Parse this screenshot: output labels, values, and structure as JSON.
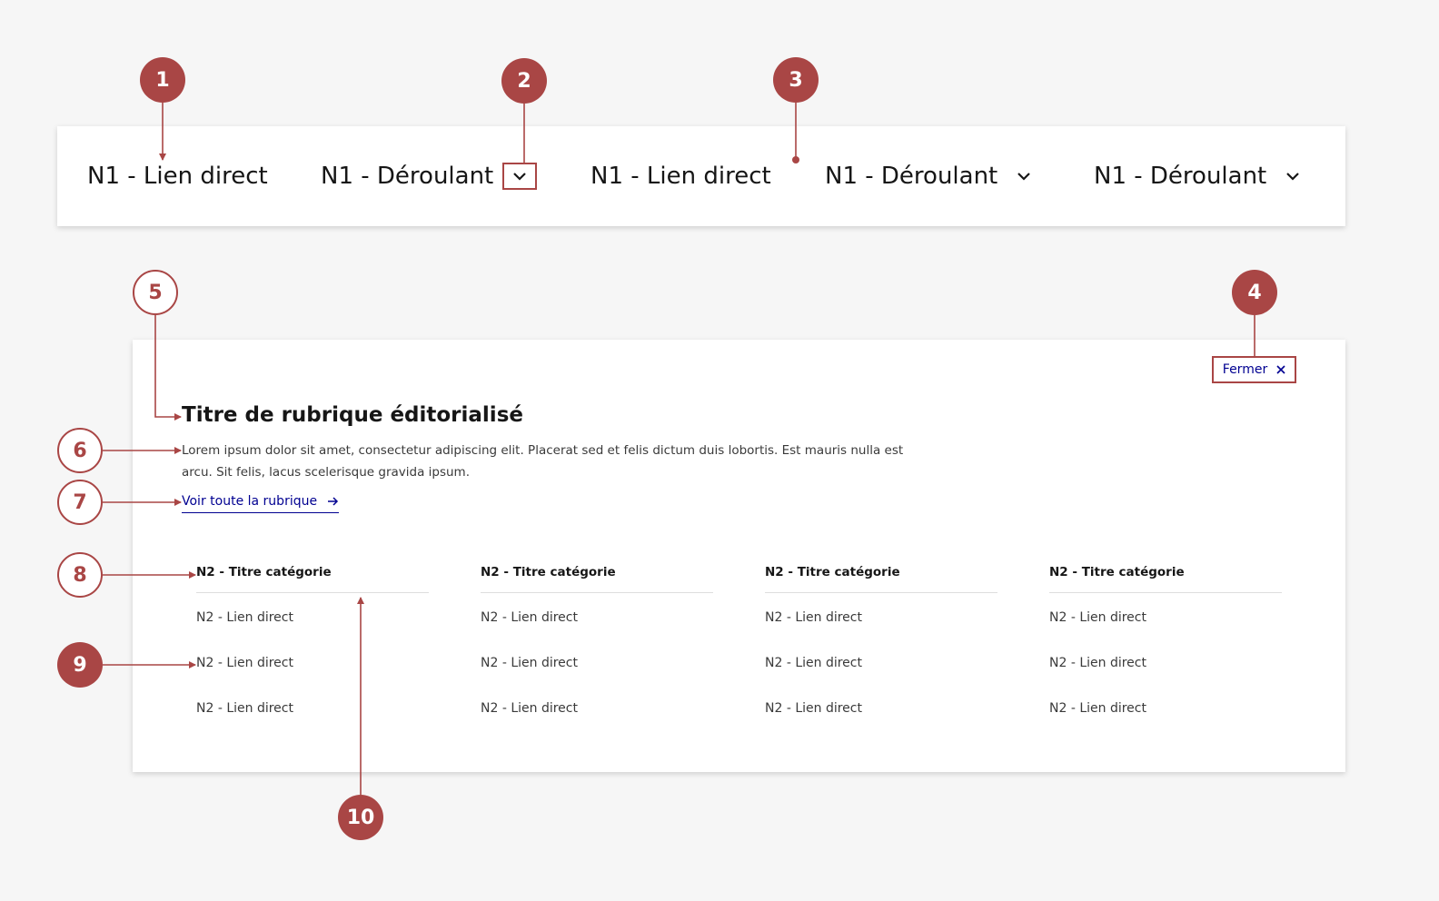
{
  "navbar": {
    "items": [
      {
        "label": "N1 - Lien direct",
        "type": "link"
      },
      {
        "label": "N1 - Déroulant",
        "type": "dropdown"
      },
      {
        "label": "N1 - Lien direct",
        "type": "link"
      },
      {
        "label": "N1 - Déroulant",
        "type": "dropdown"
      },
      {
        "label": "N1 - Déroulant",
        "type": "dropdown"
      }
    ]
  },
  "panel": {
    "close_label": "Fermer",
    "title": "Titre de rubrique éditorialisé",
    "description": "Lorem ipsum dolor sit amet, consectetur adipiscing elit. Placerat sed et felis dictum duis lobortis. Est mauris nulla est arcu. Sit felis, lacus scelerisque gravida ipsum.",
    "link_label": "Voir toute la rubrique",
    "columns": [
      {
        "title": "N2 - Titre catégorie",
        "links": [
          "N2 - Lien direct",
          "N2 - Lien direct",
          "N2 - Lien direct"
        ]
      },
      {
        "title": "N2 - Titre catégorie",
        "links": [
          "N2 - Lien direct",
          "N2 - Lien direct",
          "N2 - Lien direct"
        ]
      },
      {
        "title": "N2 - Titre catégorie",
        "links": [
          "N2 - Lien direct",
          "N2 - Lien direct",
          "N2 - Lien direct"
        ]
      },
      {
        "title": "N2 - Titre catégorie",
        "links": [
          "N2 - Lien direct",
          "N2 - Lien direct",
          "N2 - Lien direct"
        ]
      }
    ]
  },
  "annotations": [
    "1",
    "2",
    "3",
    "4",
    "5",
    "6",
    "7",
    "8",
    "9",
    "10"
  ],
  "colors": {
    "annotation": "#a94645",
    "link": "#000091",
    "text": "#161616",
    "background": "#f6f6f6"
  }
}
